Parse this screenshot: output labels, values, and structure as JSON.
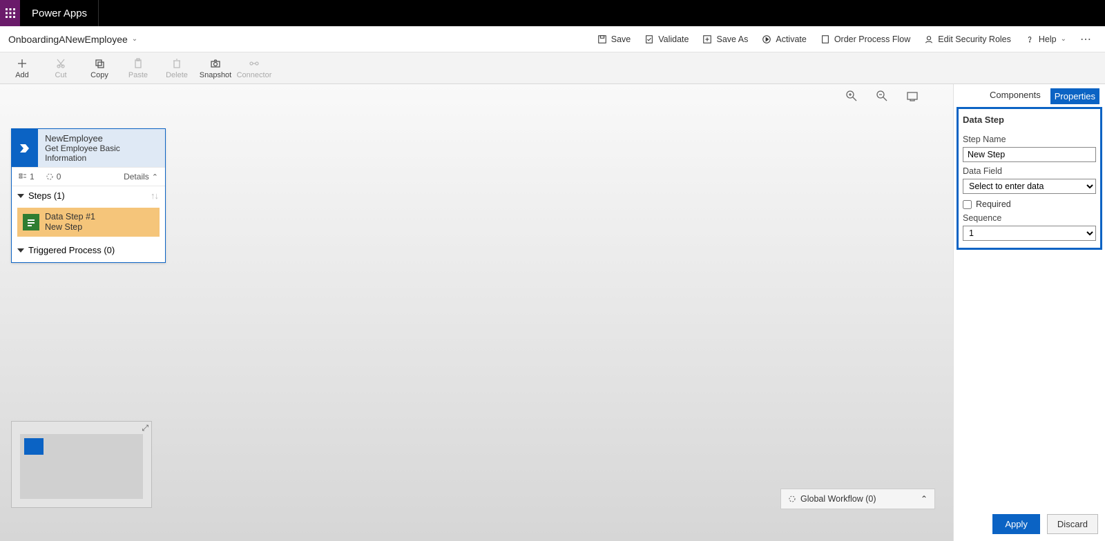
{
  "app": {
    "title": "Power Apps"
  },
  "flow": {
    "name": "OnboardingANewEmployee"
  },
  "commands": {
    "save": "Save",
    "validate": "Validate",
    "save_as": "Save As",
    "activate": "Activate",
    "order": "Order Process Flow",
    "security": "Edit Security Roles",
    "help": "Help"
  },
  "ribbon": {
    "add": "Add",
    "cut": "Cut",
    "copy": "Copy",
    "paste": "Paste",
    "delete": "Delete",
    "snapshot": "Snapshot",
    "connector": "Connector"
  },
  "panel": {
    "tabs": {
      "components": "Components",
      "properties": "Properties"
    },
    "section_title": "Data Step",
    "step_name_label": "Step Name",
    "step_name_value": "New Step",
    "data_field_label": "Data Field",
    "data_field_placeholder": "Select to enter data",
    "required_label": "Required",
    "sequence_label": "Sequence",
    "sequence_value": "1",
    "apply": "Apply",
    "discard": "Discard"
  },
  "stage": {
    "title": "NewEmployee",
    "subtitle": "Get Employee Basic Information",
    "count1": "1",
    "count0": "0",
    "details_label": "Details",
    "steps_header": "Steps (1)",
    "step1_title": "Data Step #1",
    "step1_sub": "New Step",
    "triggered": "Triggered Process (0)"
  },
  "workflow_bar": {
    "label": "Global Workflow (0)"
  }
}
